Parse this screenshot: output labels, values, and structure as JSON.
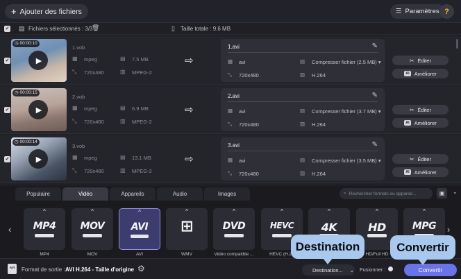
{
  "toolbar": {
    "add_files_label": "Ajouter des fichiers",
    "settings_label": "Paramètres",
    "help_label": "?"
  },
  "selection": {
    "selected_label": "Fichiers sélectionnés : 3/3",
    "total_size_label": "Taille totale : 9.6 MB"
  },
  "files": [
    {
      "duration": "00:00:10",
      "source_name": "1.vob",
      "source_format": "mpeg",
      "source_size": "7.5 MB",
      "source_resolution": "720x480",
      "source_codec": "MPEG-2",
      "target_name": "1.avi",
      "target_format": "avi",
      "target_compress": "Compresser fichier (2.5 MB)",
      "target_resolution": "720x480",
      "target_codec": "H.264"
    },
    {
      "duration": "00:00:15",
      "source_name": "2.vob",
      "source_format": "mpeg",
      "source_size": "6.9 MB",
      "source_resolution": "720x480",
      "source_codec": "MPEG-2",
      "target_name": "2.avi",
      "target_format": "avi",
      "target_compress": "Compresser fichier (3.7 MB)",
      "target_resolution": "720x480",
      "target_codec": "H.264"
    },
    {
      "duration": "00:00:14",
      "source_name": "3.vob",
      "source_format": "mpeg",
      "source_size": "13.1 MB",
      "source_resolution": "720x480",
      "source_codec": "MPEG-2",
      "target_name": "3.avi",
      "target_format": "avi",
      "target_compress": "Compresser fichier (3.5 MB)",
      "target_resolution": "720x480",
      "target_codec": "H.264"
    }
  ],
  "row_actions": {
    "edit_label": "Éditer",
    "improve_label": "Améliorer",
    "ai_badge": "AI"
  },
  "tabs": [
    {
      "label": "Populaire",
      "active": false
    },
    {
      "label": "Vidéo",
      "active": true
    },
    {
      "label": "Appareils",
      "active": false
    },
    {
      "label": "Audio",
      "active": false
    },
    {
      "label": "Images",
      "active": false
    }
  ],
  "search": {
    "placeholder": "Rechercher formats ou appareil..."
  },
  "formats": [
    {
      "logo": "MP4",
      "label": "MP4",
      "selected": false
    },
    {
      "logo": "MOV",
      "label": "MOV",
      "selected": false
    },
    {
      "logo": "AVI",
      "label": "AVI",
      "selected": true
    },
    {
      "logo": "",
      "label": "WMV",
      "selected": false
    },
    {
      "logo": "DVD",
      "label": "Vidéo compatible ...",
      "selected": false
    },
    {
      "logo": "HEVC",
      "label": "HEVC (H.26",
      "selected": false
    },
    {
      "logo": "4K",
      "label": "",
      "selected": false
    },
    {
      "logo": "HD",
      "label": "HD/Full HD",
      "selected": false
    },
    {
      "logo": "MPG",
      "label": "",
      "selected": false
    }
  ],
  "output": {
    "icon_text": "AVI",
    "label": "Format de sortie :",
    "value": "AVI H.264 - Taille d'origine"
  },
  "bottom": {
    "destination_label": "Destination...",
    "merge_label": "Fusionner :",
    "merge_on": false,
    "convert_label": "Convertir"
  },
  "callouts": {
    "destination": "Destination",
    "convert": "Convertir"
  },
  "colors": {
    "accent": "#6b73e8",
    "callout": "#a9c8ee",
    "selected_format": "#3c3d6e",
    "background": "#1f1f25"
  }
}
